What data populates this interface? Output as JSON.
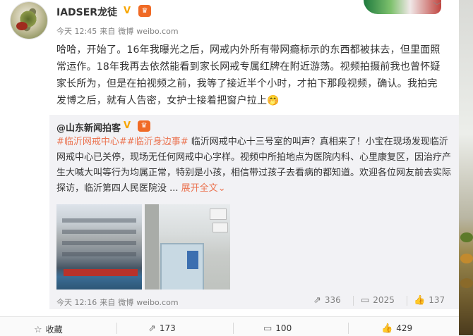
{
  "post": {
    "author": "IADSER龙徒",
    "vip_mark": "V",
    "level_mark": "♛",
    "time": "今天 12:45",
    "source_prefix": "来自",
    "source_app": "微博",
    "source_site": "weibo.com",
    "text": "哈哈，开始了。16年我曝光之后，网戒内外所有带网瘾标示的东西都被抹去，但里面照常运作。18年我再去依然能看到家长网戒专属红牌在附近游荡。视频拍摄前我也曾怀疑家长所为，但是在拍视频之前，我等了接近半个小时，才拍下那段视频，确认。我拍完发博之后，就有人告密，女护士接着把窗户拉上",
    "emoji": "🤭"
  },
  "repost": {
    "author": "@山东新闻拍客",
    "vip_mark": "V",
    "level_mark": "♛",
    "topics": [
      "#临沂网戒中心#",
      "#临沂身边事#"
    ],
    "text": " 临沂网戒中心十三号室的叫声？真相来了！小宝在现场发现临沂网戒中心已关停，现场无任何网戒中心字样。视频中所拍地点为医院内科、心里康复区，因治疗产生大喊大叫等行为均属正常，特别是小孩，相信带过孩子去看病的都知道。欢迎各位网友前去实际探访，临沂第四人民医院没 ...",
    "expand_label": "展开全文",
    "expand_arrow": "⌄",
    "time": "今天 12:16",
    "source_prefix": "来自",
    "source_app": "微博",
    "source_site": "weibo.com",
    "repost_count": "336",
    "comment_count": "2025",
    "like_count": "137"
  },
  "actions": {
    "favorite_label": "收藏",
    "repost_count": "173",
    "comment_count": "100",
    "like_count": "429"
  },
  "icons": {
    "repost": "repost-icon",
    "comment": "comment-icon",
    "like": "like-icon",
    "favorite": "star-icon",
    "chevron": "chevron-down-icon"
  },
  "colors": {
    "link": "#eb7350",
    "vip": "#f7a500",
    "level": "#f06a25",
    "repost_bg": "#f2f2f5"
  }
}
